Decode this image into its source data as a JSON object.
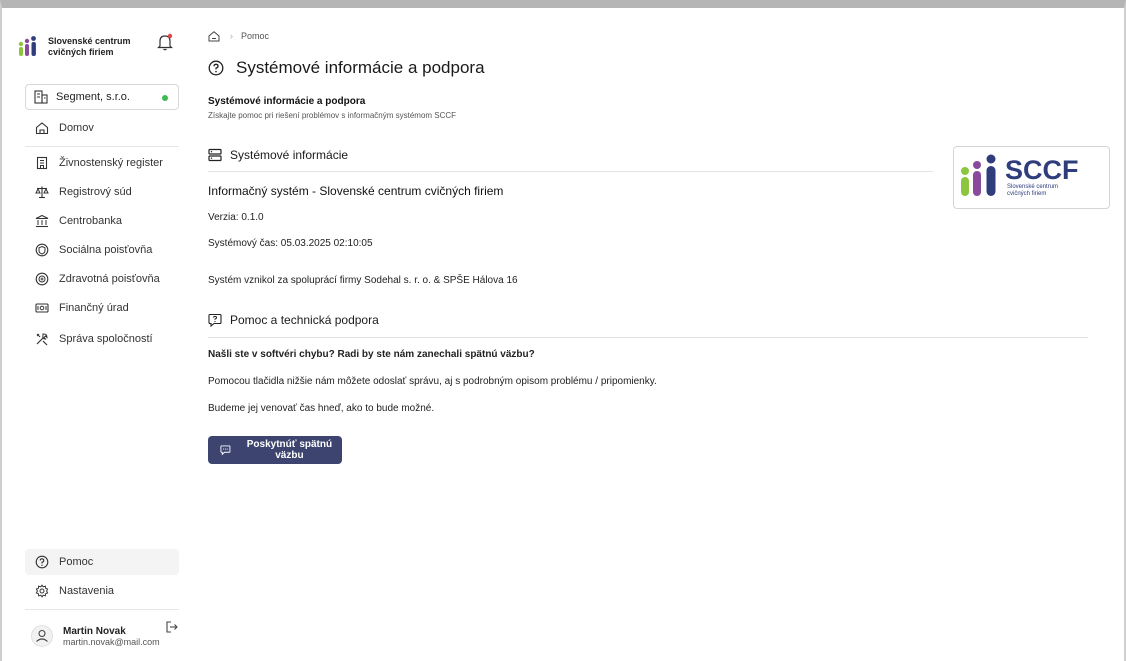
{
  "sidebar": {
    "brand_line1": "Slovenské centrum",
    "brand_line2": "cvičných firiem",
    "company": "Segment, s.r.o.",
    "items": [
      {
        "label": "Domov",
        "icon": "home-icon"
      },
      {
        "label": "Živnostenský register",
        "icon": "building-icon"
      },
      {
        "label": "Registrový súd",
        "icon": "scales-icon"
      },
      {
        "label": "Centrobanka",
        "icon": "bank-icon"
      },
      {
        "label": "Sociálna poisťovňa",
        "icon": "shield-icon"
      },
      {
        "label": "Zdravotná poisťovňa",
        "icon": "health-icon"
      },
      {
        "label": "Finančný úrad",
        "icon": "tax-icon"
      },
      {
        "label": "Správa spoločností",
        "icon": "tools-icon"
      }
    ],
    "bottom": [
      {
        "label": "Pomoc",
        "icon": "help-icon"
      },
      {
        "label": "Nastavenia",
        "icon": "gear-icon"
      }
    ],
    "user": {
      "name": "Martin Novak",
      "email": "martin.novak@mail.com"
    }
  },
  "breadcrumb": {
    "current": "Pomoc"
  },
  "page": {
    "title": "Systémové informácie a podpora",
    "subtitle": "Systémové informácie a podpora",
    "subdesc": "Získajte pomoc pri riešení problémov s informačným systémom SCCF"
  },
  "sysinfo": {
    "heading": "Systémové informácie",
    "system_name": "Informačný systém - Slovenské centrum cvičných firiem",
    "version": "Verzia: 0.1.0",
    "time": "Systémový čas: 05.03.2025 02:10:05",
    "credits": "Systém vznikol za spoluprácí firmy Sodehal s. r. o. & SPŠE Hálova 16"
  },
  "logo": {
    "text": "SCCF",
    "sub1": "Slovenské centrum",
    "sub2": "cvičných firiem"
  },
  "support": {
    "heading": "Pomoc a technická podpora",
    "line1": "Našli ste v softvéri chybu? Radi by ste nám zanechali spätnú väzbu?",
    "line2": "Pomocou tlačidla nižšie nám môžete odoslať správu, aj s podrobným opisom problému / pripomienky.",
    "line3": "Budeme jej venovať čas hneď, ako to bude možné.",
    "button": "Poskytnúť spätnú väzbu"
  },
  "colors": {
    "accent": "#3d4470",
    "status_online": "#3dbb52",
    "logo_blue": "#2f3d7c",
    "logo_green": "#8cc63f",
    "logo_purple": "#8a4a9c"
  }
}
